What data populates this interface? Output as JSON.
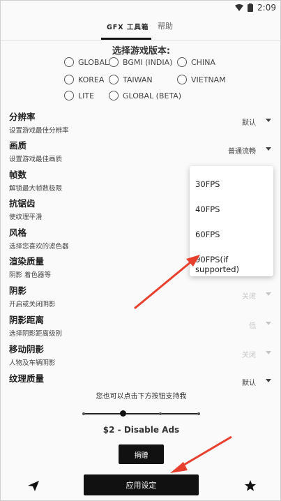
{
  "status_bar": {
    "time": "2:09"
  },
  "tabs": {
    "active": "GFX 工具箱",
    "help": "帮助"
  },
  "version": {
    "title": "选择游戏版本:",
    "options": [
      "GLOBAL",
      "BGMI (INDIA)",
      "CHINA",
      "KOREA",
      "TAIWAN",
      "VIETNAM",
      "LITE",
      "GLOBAL (BETA)"
    ]
  },
  "settings": [
    {
      "title": "分辨率",
      "desc": "设置游戏最佳分辨率",
      "value": "默认"
    },
    {
      "title": "画质",
      "desc": "设置游戏最佳画质",
      "value": "普通流畅"
    },
    {
      "title": "帧数",
      "desc": "解锁最大帧数极限"
    },
    {
      "title": "抗锯齿",
      "desc": "使纹理平滑"
    },
    {
      "title": "风格",
      "desc": "选择您喜欢的滤色器"
    },
    {
      "title": "渲染质量",
      "desc": "阴影 着色器等"
    },
    {
      "title": "阴影",
      "desc": "开启或关闭阴影",
      "value": "关闭"
    },
    {
      "title": "阴影距离",
      "desc": "选择阴影距离级别",
      "value": "低"
    },
    {
      "title": "移动阴影",
      "desc": "人物及车辆阴影",
      "value": "关闭"
    },
    {
      "title": "纹理质量",
      "desc": "",
      "value": "默认"
    }
  ],
  "fps_dropdown": {
    "options": [
      "30FPS",
      "40FPS",
      "60FPS",
      "90FPS(if supported)"
    ]
  },
  "support": {
    "text": "您也可以点击下方按钮支持我",
    "price": "$2 - Disable Ads",
    "donate_label": "捐赠"
  },
  "apply_label": "应用设定",
  "colors": {
    "annotation_arrow": "#e8402f",
    "primary_button": "#111111"
  }
}
